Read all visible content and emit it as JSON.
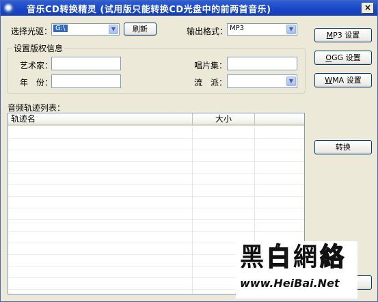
{
  "window": {
    "title": "音乐CD转换精灵   (试用版只能转换CD光盘中的前两首音乐)",
    "close_label": "×"
  },
  "drive": {
    "label": "选择光驱：",
    "value": "G:\\"
  },
  "refresh_button": "刷新",
  "output_format": {
    "label": "输出格式：",
    "value": "MP3"
  },
  "copyright_group": {
    "title": "设置版权信息",
    "artist_label": "艺术家：",
    "album_label": "唱片集：",
    "year_label": "年　份：",
    "genre_label": "流　派：",
    "artist_value": "",
    "album_value": "",
    "year_value": "",
    "genre_value": ""
  },
  "side_buttons": {
    "mp3": {
      "hot": "M",
      "rest": "P3 设置"
    },
    "ogg": {
      "hot": "O",
      "rest": "GG 设置"
    },
    "wma": {
      "hot": "W",
      "rest": "MA 设置"
    },
    "convert": "转换"
  },
  "track_list": {
    "label": "音频轨迹列表：",
    "columns": [
      "轨迹名",
      "大小",
      ""
    ],
    "rows": []
  },
  "watermark": {
    "logo_char1": "黑",
    "logo_char2": "白",
    "logo_char3": "網",
    "logo_char4": "絡",
    "url": "www.HeiBai.Net"
  }
}
